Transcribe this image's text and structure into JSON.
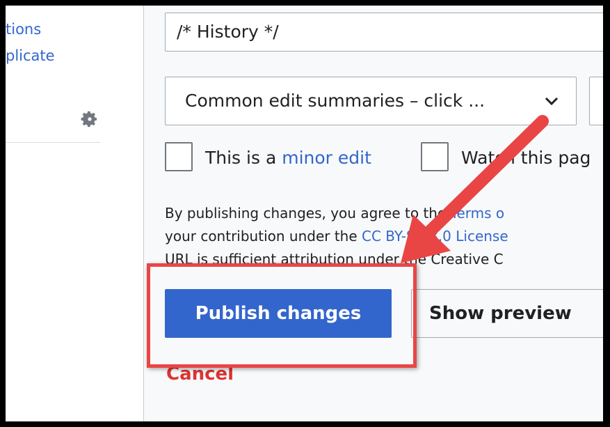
{
  "sidebar": {
    "links": [
      "tions",
      "plicate"
    ],
    "gear_icon": "gear-icon"
  },
  "editor": {
    "summary_value": "/* History */",
    "summary_select": "Common edit summaries – click ...",
    "minor_edit": {
      "prefix": "This is a ",
      "link": "minor edit"
    },
    "watch_label": "Watch this pag",
    "legal": {
      "line1_a": "By publishing changes, you agree to the ",
      "line1_link": "Terms o",
      "line2_a": "your contribution under the ",
      "line2_link": "CC BY-SA 3.0 License",
      "line3": "URL is sufficient attribution under the Creative C"
    },
    "publish_label": "Publish changes",
    "preview_label": "Show preview",
    "cancel_label": "Cancel"
  },
  "colors": {
    "link": "#3366cc",
    "primary_button": "#3366cc",
    "cancel": "#dd3333",
    "annotation": "#e94545"
  }
}
